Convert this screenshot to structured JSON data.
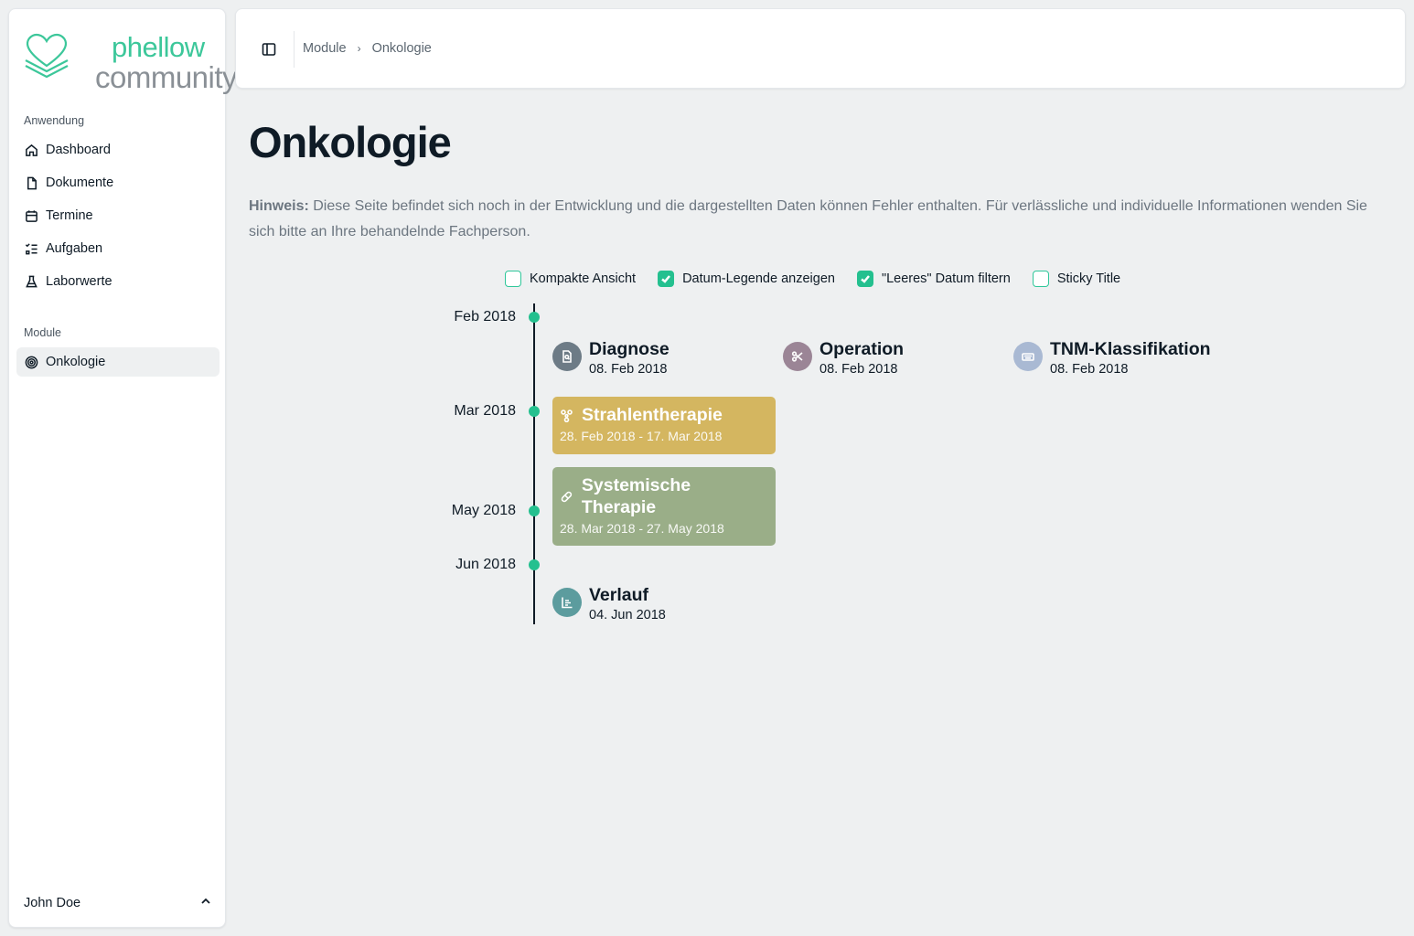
{
  "brand": {
    "line1": "phellow",
    "line2": "community"
  },
  "sidebar": {
    "section_app": "Anwendung",
    "items": [
      {
        "label": "Dashboard",
        "icon": "home-icon"
      },
      {
        "label": "Dokumente",
        "icon": "file-icon"
      },
      {
        "label": "Termine",
        "icon": "calendar-icon"
      },
      {
        "label": "Aufgaben",
        "icon": "list-check-icon"
      },
      {
        "label": "Laborwerte",
        "icon": "flask-icon"
      }
    ],
    "section_modules": "Module",
    "modules": [
      {
        "label": "Onkologie",
        "icon": "target-icon",
        "active": true
      }
    ],
    "user": "John Doe"
  },
  "header": {
    "breadcrumb": [
      "Module",
      "Onkologie"
    ]
  },
  "main": {
    "title": "Onkologie",
    "notice_label": "Hinweis:",
    "notice_text": " Diese Seite befindet sich noch in der Entwicklung und die dargestellten Daten können Fehler enthalten. Für verlässliche und individuelle Informationen wenden Sie sich bitte an Ihre behandelnde Fachperson.",
    "options": [
      {
        "label": "Kompakte Ansicht",
        "checked": false
      },
      {
        "label": "Datum-Legende anzeigen",
        "checked": true
      },
      {
        "label": "\"Leeres\" Datum filtern",
        "checked": true
      },
      {
        "label": "Sticky Title",
        "checked": false
      }
    ]
  },
  "timeline": {
    "months": [
      "Feb 2018",
      "Mar 2018",
      "May 2018",
      "Jun 2018"
    ],
    "events": [
      {
        "title": "Diagnose",
        "date": "08. Feb 2018",
        "icon": "file-search-icon",
        "color": "#6d7b86"
      },
      {
        "title": "Operation",
        "date": "08. Feb 2018",
        "icon": "scissors-icon",
        "color": "#9b8596"
      },
      {
        "title": "TNM-Klassifikation",
        "date": "08. Feb 2018",
        "icon": "keyboard-icon",
        "color": "#a9b9d3"
      },
      {
        "title": "Verlauf",
        "date": "04. Jun 2018",
        "icon": "chart-icon",
        "color": "#5c9c9e"
      }
    ],
    "periods": [
      {
        "title": "Strahlentherapie",
        "date": "28. Feb 2018 - 17. Mar 2018",
        "icon": "radiation-icon",
        "color": "#d4b660"
      },
      {
        "title": "Systemische Therapie",
        "date": "28. Mar 2018 - 27. May 2018",
        "icon": "pill-icon",
        "color": "#9aae88"
      }
    ]
  }
}
